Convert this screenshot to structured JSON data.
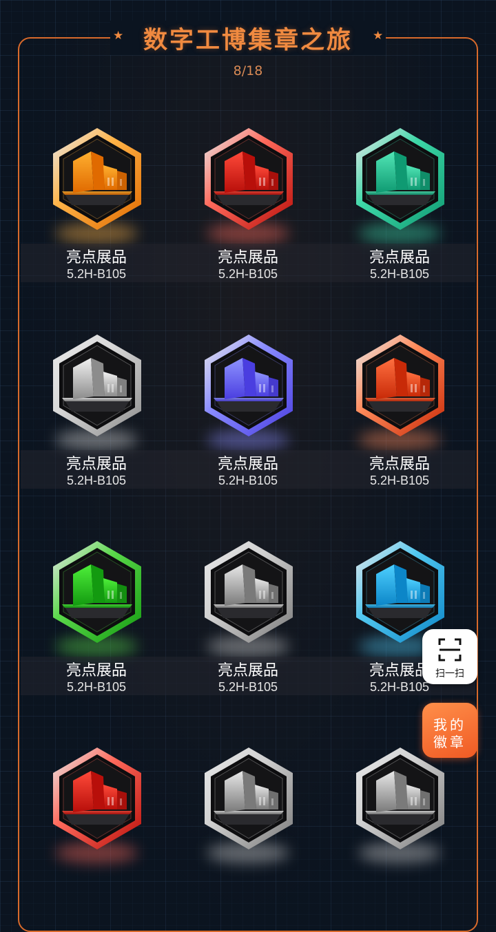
{
  "header": {
    "title": "数字工博集章之旅",
    "progress_text": "8/18",
    "star_icon": "★"
  },
  "badges": [
    {
      "name": "亮点展品",
      "code": "5.2H-B105",
      "color": "orange",
      "frame": "#ffb347",
      "fill_light": "#ffb030",
      "fill_dark": "#e06a00"
    },
    {
      "name": "亮点展品",
      "code": "5.2H-B105",
      "color": "red",
      "frame": "#ff6a5c",
      "fill_light": "#ff4a3a",
      "fill_dark": "#b80f0a"
    },
    {
      "name": "亮点展品",
      "code": "5.2H-B105",
      "color": "teal",
      "frame": "#3ed8a8",
      "fill_light": "#52e6b6",
      "fill_dark": "#0f9a72"
    },
    {
      "name": "亮点展品",
      "code": "5.2H-B105",
      "color": "gray",
      "frame": "#d8d8d8",
      "fill_light": "#f2f2f2",
      "fill_dark": "#8c8c8c"
    },
    {
      "name": "亮点展品",
      "code": "5.2H-B105",
      "color": "blue-violet",
      "frame": "#8a8cff",
      "fill_light": "#8f94ff",
      "fill_dark": "#4a3ee0"
    },
    {
      "name": "亮点展品",
      "code": "5.2H-B105",
      "color": "orange-red",
      "frame": "#ff8a5a",
      "fill_light": "#ff7040",
      "fill_dark": "#c82a08"
    },
    {
      "name": "亮点展品",
      "code": "5.2H-B105",
      "color": "green",
      "frame": "#5ad84a",
      "fill_light": "#4ef03a",
      "fill_dark": "#139a10"
    },
    {
      "name": "亮点展品",
      "code": "5.2H-B105",
      "color": "gray",
      "frame": "#d0d0d0",
      "fill_light": "#e8e8e8",
      "fill_dark": "#7a7a7a"
    },
    {
      "name": "亮点展品",
      "code": "5.2H-B105",
      "color": "sky-blue",
      "frame": "#52c8f0",
      "fill_light": "#4ed0ff",
      "fill_dark": "#0c86c8"
    },
    {
      "color": "red",
      "frame": "#ff6a5c",
      "fill_light": "#ff4a3a",
      "fill_dark": "#b80f0a"
    },
    {
      "color": "gray",
      "frame": "#d0d0d0",
      "fill_light": "#e8e8e8",
      "fill_dark": "#7a7a7a"
    },
    {
      "color": "gray",
      "frame": "#d0d0d0",
      "fill_light": "#e8e8e8",
      "fill_dark": "#7a7a7a"
    }
  ],
  "float_buttons": {
    "scan_label": "扫一扫",
    "scan_icon": "scan-icon",
    "my_badges_line1": "我的",
    "my_badges_line2": "徽章"
  },
  "colors": {
    "accent": "#f08a40",
    "panel_border": "#d96a2b",
    "background": "#0b1420",
    "my_badges_bg": "#f05a24"
  }
}
